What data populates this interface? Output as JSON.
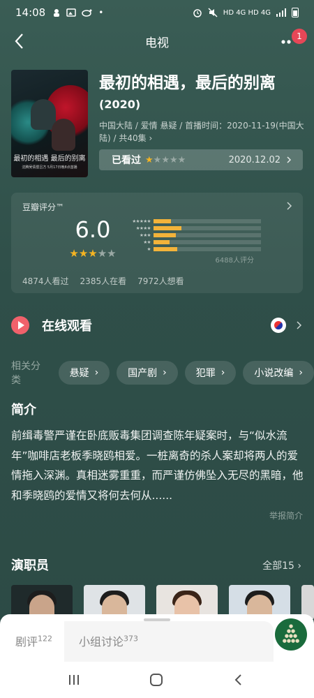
{
  "status_bar": {
    "time": "14:08",
    "right_indicators": "HD 4G HD 4G"
  },
  "nav": {
    "title": "电视",
    "badge": "1"
  },
  "movie": {
    "title": "最初的相遇，最后的别离",
    "year": "(2020)",
    "meta": "中国大陆 / 爱情 悬疑 / 首播时间：2020-11-19(中国大陆) / 共40集",
    "poster_title": "最初的相遇 最后的别离",
    "poster_subtitle": "沈腾吴倩暨吕方 5月17日晚8点首播",
    "seen_label": "已看过",
    "my_rating_stars": 1,
    "seen_date": "2020.12.02"
  },
  "rating": {
    "label": "豆瓣评分™",
    "score": "6.0",
    "avg_stars": 3,
    "histogram": [
      {
        "stars": "★★★★★",
        "fraction": 0.16
      },
      {
        "stars": "★★★★",
        "fraction": 0.26
      },
      {
        "stars": "★★★",
        "fraction": 0.21
      },
      {
        "stars": "★★",
        "fraction": 0.15
      },
      {
        "stars": "★",
        "fraction": 0.22
      }
    ],
    "count": "6488人评分",
    "stats": [
      "4874人看过",
      "2385人在看",
      "7972人想看"
    ]
  },
  "watch": {
    "label": "在线观看"
  },
  "categories": {
    "label": "相关分类",
    "items": [
      "悬疑",
      "国产剧",
      "犯罪",
      "小说改编"
    ]
  },
  "summary": {
    "title": "简介",
    "text": "前缉毒警严谨在卧底贩毒集团调查陈年疑案时，与“似水流年”咖啡店老板季晓鸥相爱。一桩离奇的杀人案却将两人的爱情拖入深渊。真相迷雾重重，而严谨仿佛坠入无尽的黑暗，他和季晓鸥的爱情又将何去何从......",
    "report": "举报简介"
  },
  "cast": {
    "title": "演职员",
    "all_label": "全部15"
  },
  "sheet": {
    "tab1_label": "剧评",
    "tab1_count": "122",
    "tab2_label": "小组讨论",
    "tab2_count": "373"
  },
  "colors": {
    "accent_star": "#f5b422",
    "play_red": "#f0616b",
    "badge_red": "#e64757",
    "bg_teal": "#2f4f49"
  }
}
